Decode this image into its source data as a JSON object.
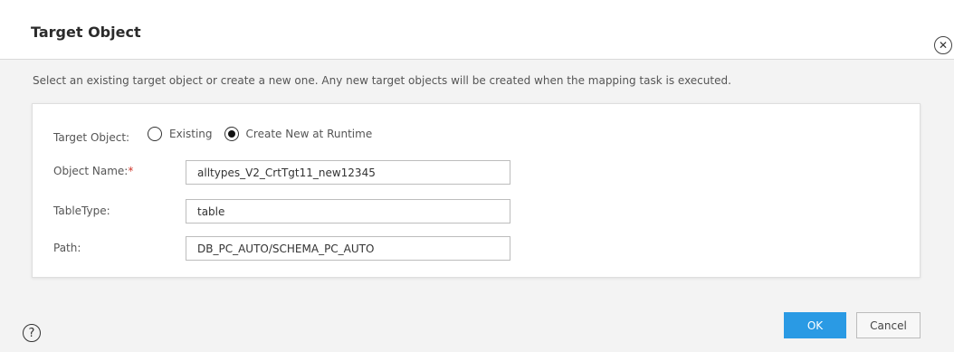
{
  "dialog": {
    "title": "Target Object",
    "close_icon": "close-circle-icon",
    "description": "Select an existing target object or create a new one. Any new target objects will be created when the mapping task is executed."
  },
  "form": {
    "target_object_label": "Target Object:",
    "radio_options": [
      {
        "label": "Existing",
        "selected": false
      },
      {
        "label": "Create New at Runtime",
        "selected": true
      }
    ],
    "object_name_label": "Object Name:",
    "object_name_required": "*",
    "object_name_value": "alltypes_V2_CrtTgt11_new12345",
    "table_type_label": "TableType:",
    "table_type_value": "table",
    "path_label": "Path:",
    "path_value": "DB_PC_AUTO/SCHEMA_PC_AUTO"
  },
  "footer": {
    "help_icon": "help-icon",
    "ok_label": "OK",
    "cancel_label": "Cancel"
  },
  "colors": {
    "primary": "#2a9ae4",
    "required": "#d0362b"
  }
}
